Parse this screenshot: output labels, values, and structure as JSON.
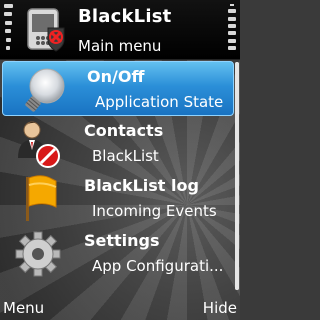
{
  "header": {
    "title": "BlackList",
    "subtitle": "Main menu",
    "icon": "blacklist-app-icon"
  },
  "menu": {
    "items": [
      {
        "label": "On/Off",
        "sub": "Application State",
        "icon": "lightbulb-icon",
        "selected": true
      },
      {
        "label": "Contacts",
        "sub": "BlackList",
        "icon": "blocked-contact-icon",
        "selected": false
      },
      {
        "label": "BlackList log",
        "sub": "Incoming Events",
        "icon": "flag-icon",
        "selected": false
      },
      {
        "label": "Settings",
        "sub": "App Configurati...",
        "icon": "gear-icon",
        "selected": false
      }
    ]
  },
  "softkeys": {
    "left": "Menu",
    "right": "Hide"
  },
  "colors": {
    "selection": "#2b8fd8",
    "background": "#3a3a3a",
    "header": "#000000"
  }
}
